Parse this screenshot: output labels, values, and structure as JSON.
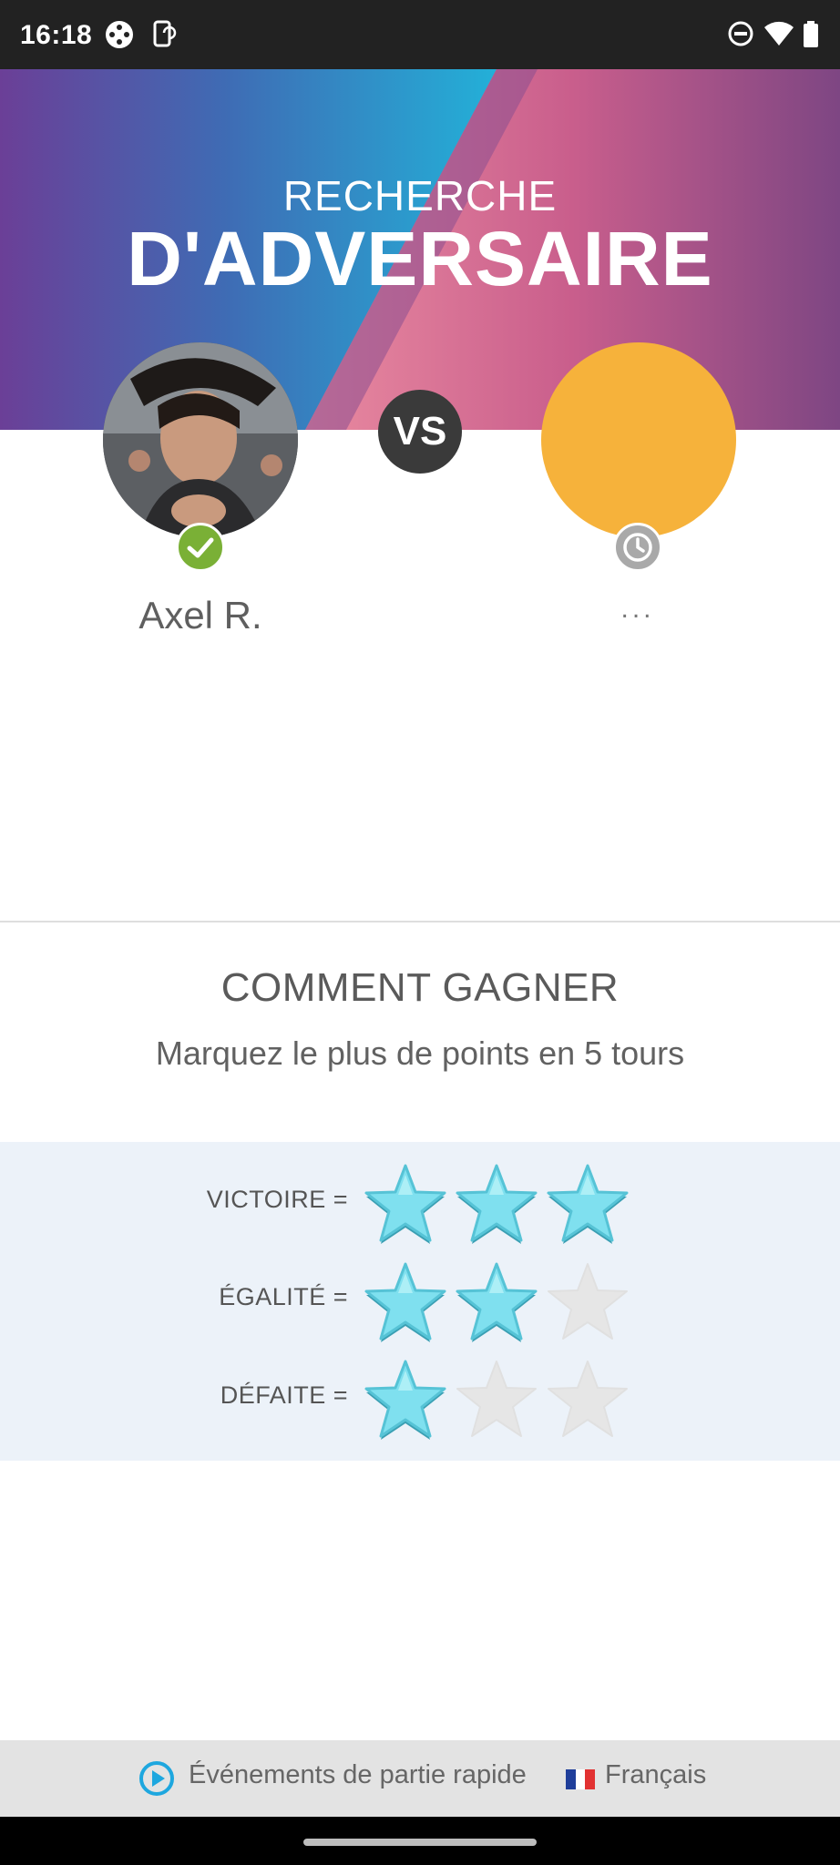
{
  "status_bar": {
    "time": "16:18",
    "left_icons": [
      "gamepad-icon",
      "phone-rotate-icon"
    ],
    "right_icons": [
      "do-not-disturb-icon",
      "wifi-icon",
      "battery-icon"
    ]
  },
  "header": {
    "title_small": "RECHERCHE",
    "title_big": "D'ADVERSAIRE"
  },
  "match": {
    "vs_label": "VS",
    "player": {
      "name": "Axel R.",
      "status_icon": "check-icon"
    },
    "opponent": {
      "name": "...",
      "status_icon": "clock-icon",
      "color": "#f6b23b"
    }
  },
  "how_to_win": {
    "title": "COMMENT GAGNER",
    "subtitle": "Marquez le plus de points en 5 tours"
  },
  "rewards": [
    {
      "label": "VICTOIRE =",
      "stars_filled": 3,
      "stars_total": 3
    },
    {
      "label": "ÉGALITÉ =",
      "stars_filled": 2,
      "stars_total": 3
    },
    {
      "label": "DÉFAITE =",
      "stars_filled": 1,
      "stars_total": 3
    }
  ],
  "footer": {
    "events_link": "Événements de partie rapide",
    "language": "Français"
  },
  "colors": {
    "accent_blue": "#1ea7df",
    "star_filled": "#7fe0ef",
    "star_empty": "#e6e6e6",
    "check_green": "#7ab036"
  }
}
